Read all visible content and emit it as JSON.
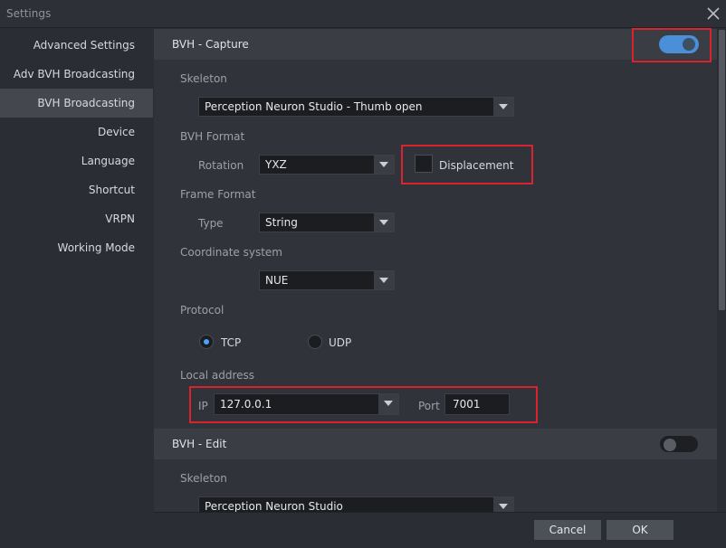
{
  "window": {
    "title": "Settings"
  },
  "sidebar": {
    "items": [
      {
        "label": "Advanced Settings"
      },
      {
        "label": "Adv BVH Broadcasting"
      },
      {
        "label": "BVH Broadcasting"
      },
      {
        "label": "Device"
      },
      {
        "label": "Language"
      },
      {
        "label": "Shortcut"
      },
      {
        "label": "VRPN"
      },
      {
        "label": "Working Mode"
      }
    ],
    "active": "BVH Broadcasting"
  },
  "capture": {
    "title": "BVH - Capture",
    "enabled": true,
    "skeleton_label": "Skeleton",
    "skeleton_value": "Perception Neuron Studio - Thumb open",
    "bvh_format_label": "BVH Format",
    "rotation_label": "Rotation",
    "rotation_value": "YXZ",
    "displacement_label": "Displacement",
    "displacement_checked": false,
    "frame_format_label": "Frame Format",
    "type_label": "Type",
    "type_value": "String",
    "coord_label": "Coordinate system",
    "coord_value": "NUE",
    "protocol_label": "Protocol",
    "tcp_label": "TCP",
    "udp_label": "UDP",
    "protocol_selected": "TCP",
    "local_address_label": "Local address",
    "ip_label": "IP",
    "ip_value": "127.0.0.1",
    "port_label": "Port",
    "port_value": "7001"
  },
  "edit": {
    "title": "BVH - Edit",
    "enabled": false,
    "skeleton_label": "Skeleton",
    "skeleton_value": "Perception Neuron Studio"
  },
  "footer": {
    "cancel_label": "Cancel",
    "ok_label": "OK"
  },
  "colors": {
    "accent": "#4a8fd8",
    "highlight": "#d9232e",
    "active_item": "#44474e"
  }
}
